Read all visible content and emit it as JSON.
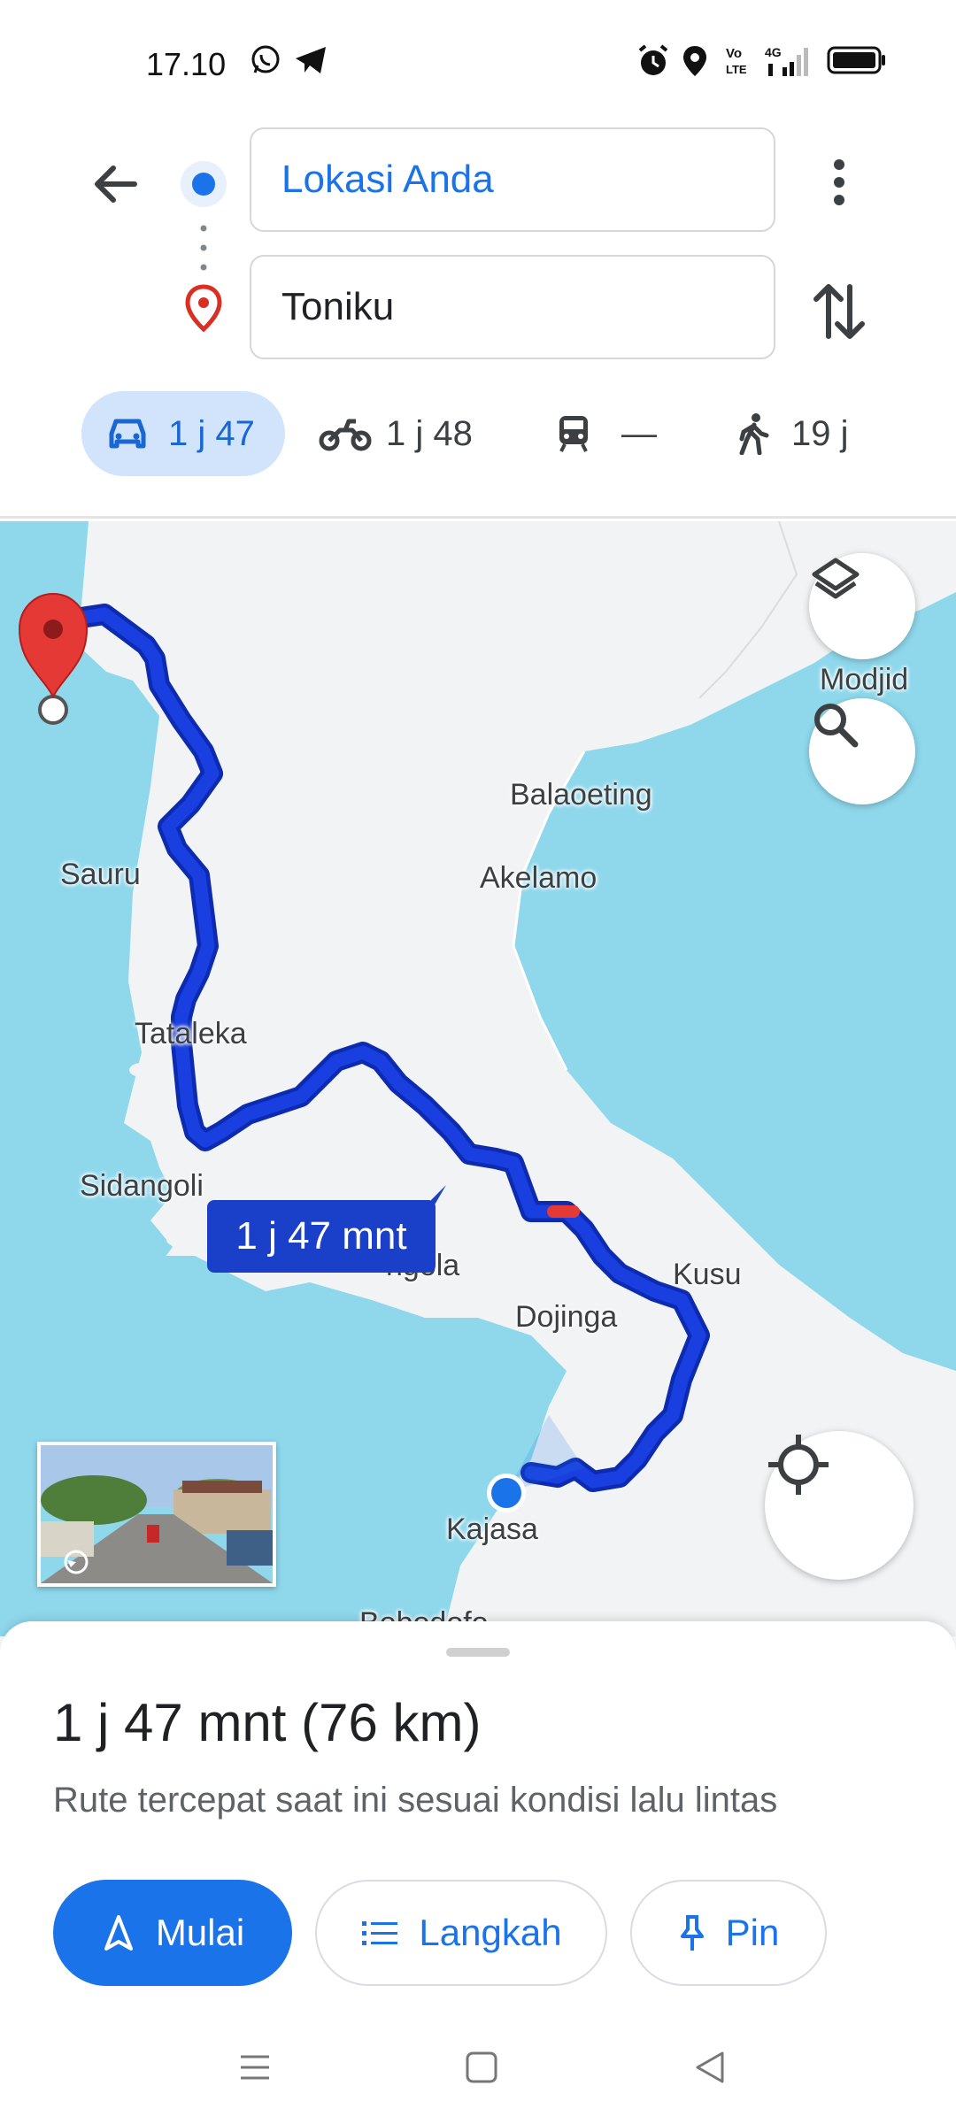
{
  "status_bar": {
    "time": "17.10",
    "icons": [
      "whatsapp-icon",
      "telegram-icon",
      "alarm-icon",
      "location-icon",
      "volte-icon",
      "4g-signal-icon",
      "battery-icon"
    ]
  },
  "directions": {
    "origin": "Lokasi Anda",
    "destination": "Toniku",
    "modes": [
      {
        "name": "car",
        "label": "1 j 47",
        "active": true
      },
      {
        "name": "motorcycle",
        "label": "1 j 48",
        "active": false
      },
      {
        "name": "transit",
        "label": "—",
        "active": false
      },
      {
        "name": "walk",
        "label": "19 j",
        "active": false
      }
    ]
  },
  "map": {
    "labels": [
      "Modjid",
      "Balaoeting",
      "Akelamo",
      "Sauru",
      "Tataleka",
      "Sidangoli",
      "ngola",
      "Kusu",
      "Dojinga",
      "Kajasa",
      "Bobodofo"
    ],
    "eta_chip": "1 j 47 mnt",
    "colors": {
      "water": "#8fd8ec",
      "land": "#f1f3f4",
      "route": "#1a3fe0",
      "route_outline": "#0d2bb0",
      "destination_pin": "#e53935"
    }
  },
  "sheet": {
    "summary": "1 j 47 mnt (76 km)",
    "subtitle": "Rute tercepat saat ini sesuai kondisi lalu lintas",
    "buttons": {
      "start": "Mulai",
      "steps": "Langkah",
      "pin": "Pin"
    },
    "accent": "#1a73e8"
  }
}
